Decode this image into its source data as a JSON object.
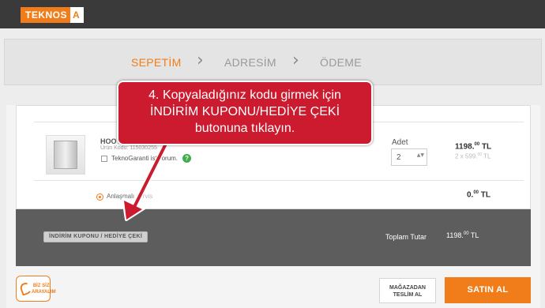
{
  "brand": {
    "logo_main": "TEKNOS",
    "logo_tail": "A",
    "accent": "#f07d1a"
  },
  "steps": [
    {
      "label": "SEPETİM",
      "active": true
    },
    {
      "label": "ADRESİM",
      "active": false
    },
    {
      "label": "ÖDEME",
      "active": false
    }
  ],
  "chevron": "›",
  "product": {
    "name": "HOOVER",
    "code": "Ürün Kodu: 115030255",
    "warranty_label": "TeknoGaranti istiyorum.",
    "help_glyph": "?",
    "qty_label": "Adet",
    "qty_value": "2",
    "qty_arrows": "▲▼",
    "price_int": "1198.",
    "price_dec": "00",
    "price_cur": " TL",
    "price_sub_int": "2 x 599.",
    "price_sub_dec": "00",
    "price_sub_cur": " TL"
  },
  "service": {
    "label": "Anlaşmalı",
    "label_tail": "servis",
    "price_int": "0.",
    "price_dec": "00",
    "price_cur": " TL"
  },
  "totals": {
    "coupon_button": "İNDİRİM KUPONU / HEDİYE ÇEKİ",
    "total_label": "Toplam Tutar",
    "total_int": "1198.",
    "total_dec": "00",
    "total_cur": " TL"
  },
  "footer": {
    "callme_line1": "BİZ SİZİ",
    "callme_line2": "ARAYALIM",
    "pickup_line1": "MAĞAZADAN",
    "pickup_line2": "TESLİM AL",
    "buy_button": "SATIN AL"
  },
  "callout": {
    "line1": "4. Kopyaladığınız kodu girmek için",
    "line2": "İNDİRİM KUPONU/HEDİYE ÇEKİ",
    "line3": "butonuna  tıklayın."
  }
}
